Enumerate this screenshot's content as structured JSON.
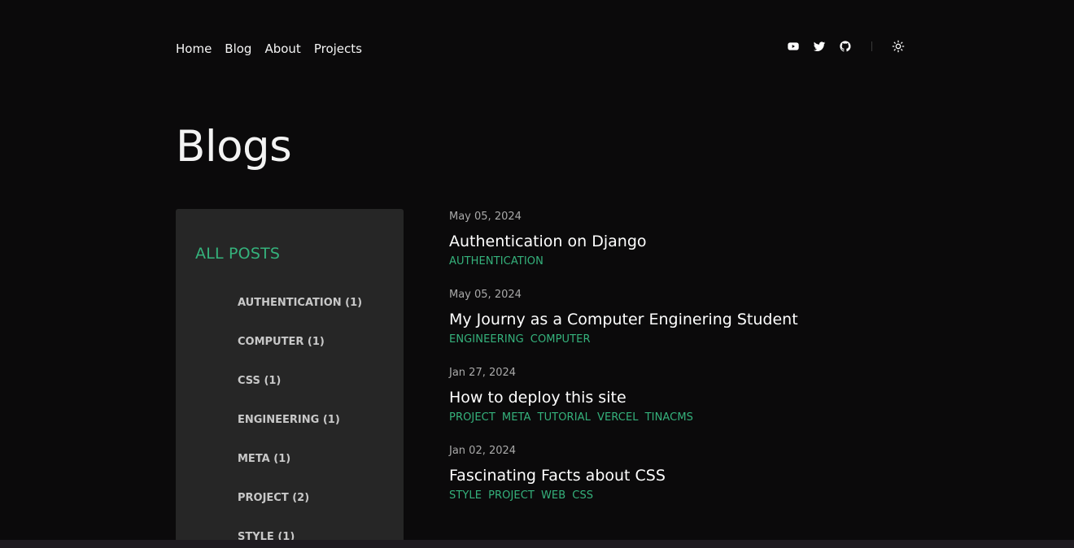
{
  "nav": {
    "items": [
      "Home",
      "Blog",
      "About",
      "Projects"
    ]
  },
  "social": {
    "icons": [
      "youtube-icon",
      "twitter-icon",
      "github-icon",
      "theme-toggle-icon"
    ]
  },
  "page": {
    "title": "Blogs"
  },
  "sidebar": {
    "title": "ALL POSTS",
    "tags": [
      "AUTHENTICATION (1)",
      "COMPUTER (1)",
      "CSS (1)",
      "ENGINEERING (1)",
      "META (1)",
      "PROJECT (2)",
      "STYLE (1)"
    ]
  },
  "posts": [
    {
      "date": "May 05, 2024",
      "title": "Authentication on Django",
      "tags": [
        "AUTHENTICATION"
      ]
    },
    {
      "date": "May 05, 2024",
      "title": "My Journy as a Computer Enginering Student",
      "tags": [
        "ENGINEERING",
        "COMPUTER"
      ]
    },
    {
      "date": "Jan 27, 2024",
      "title": "How to deploy this site",
      "tags": [
        "PROJECT",
        "META",
        "TUTORIAL",
        "VERCEL",
        "TINACMS"
      ]
    },
    {
      "date": "Jan 02, 2024",
      "title": "Fascinating Facts about CSS",
      "tags": [
        "STYLE",
        "PROJECT",
        "WEB",
        "CSS"
      ]
    }
  ],
  "colors": {
    "background": "#0b0a0b",
    "panel": "#262626",
    "accent": "#35b27c",
    "text": "#f3f3f3",
    "muted": "#a9a9a9"
  }
}
